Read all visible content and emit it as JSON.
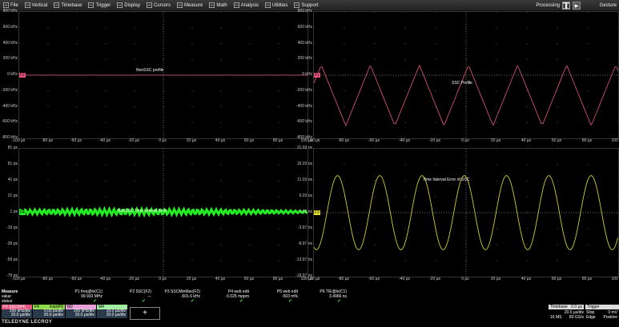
{
  "menu": {
    "items": [
      {
        "label": "File",
        "icon": "file-icon"
      },
      {
        "label": "Vertical",
        "icon": "vertical-icon"
      },
      {
        "label": "Timebase",
        "icon": "timebase-icon"
      },
      {
        "label": "Trigger",
        "icon": "trigger-icon"
      },
      {
        "label": "Display",
        "icon": "display-icon"
      },
      {
        "label": "Cursors",
        "icon": "cursors-icon"
      },
      {
        "label": "Measure",
        "icon": "measure-icon"
      },
      {
        "label": "Math",
        "icon": "math-icon"
      },
      {
        "label": "Analysis",
        "icon": "analysis-icon"
      },
      {
        "label": "Utilities",
        "icon": "utilities-icon"
      },
      {
        "label": "Support",
        "icon": "support-icon"
      }
    ],
    "processing_label": "Processing",
    "gesture_label": "Gesture"
  },
  "colors": {
    "pink": "#e8557f",
    "green": "#22ee22",
    "yellow": "#e6e62e",
    "f4": "#8fdc4a",
    "m2": "#e8a0d8",
    "m4": "#a0f0a0"
  },
  "panels": {
    "tl": {
      "yticks": [
        "800 kHz",
        "600 kHz",
        "400 kHz",
        "200 kHz",
        "0 kHz",
        "-200 kHz",
        "-400 kHz",
        "-600 kHz",
        "-800 kHz"
      ],
      "xticks": [
        "-100 µs",
        "-80 µs",
        "-60 µs",
        "-40 µs",
        "-20 µs",
        "0 µs",
        "20 µs",
        "40 µs",
        "60 µs",
        "80 µs",
        "100 µs"
      ],
      "annotation": "NonSSC profile",
      "marker": "F2"
    },
    "tr": {
      "yticks": [
        "800 kHz",
        "600 kHz",
        "400 kHz",
        "200 kHz",
        "0 kHz",
        "-200 kHz",
        "-400 kHz",
        "-600 kHz",
        "-800 kHz"
      ],
      "xticks": [
        "-100 µs",
        "-80 µs",
        "-60 µs",
        "-40 µs",
        "-20 µs",
        "0 µs",
        "20 µs",
        "40 µs",
        "60 µs",
        "80 µs",
        "100 µs"
      ],
      "annotation": "SSC Profile",
      "marker": "F1"
    },
    "bl": {
      "yticks": [
        "81 ps",
        "61 ps",
        "41 ps",
        "21 ps",
        "1 ps",
        "-19 ps",
        "-39 ps",
        "-59 ps",
        "-79 ps"
      ],
      "xticks": [
        "-100 µs",
        "-80 µs",
        "-60 µs",
        "-40 µs",
        "-20 µs",
        "0 µs",
        "20 µs",
        "40 µs",
        "60 µs",
        "80 µs",
        "100 µs"
      ],
      "annotation": "NonSSC Time Interval Error",
      "marker": "F4"
    },
    "br": {
      "yticks": [
        "21.03 ns",
        "16.03 ns",
        "11.03 ns",
        "6.03 ns",
        "1.03 ns",
        "-3.97 ns",
        "-8.97 ns",
        "-13.97 ns",
        "-18.97 ns"
      ],
      "xticks": [
        "-100 µs",
        "-80 µs",
        "-60 µs",
        "-40 µs",
        "-20 µs",
        "0 µs",
        "20 µs",
        "40 µs",
        "60 µs",
        "80 µs",
        "100 µs"
      ],
      "annotation": "Time Interval Error of SSC",
      "marker": "F3"
    }
  },
  "measure": {
    "row_labels": [
      "Measure",
      "value",
      "status"
    ],
    "params": [
      {
        "name": "P1 freq@lv(C1)",
        "value": "99.933 MHz"
      },
      {
        "name": "P2 SSC(F2)",
        "value": "---"
      },
      {
        "name": "P3 SSCMinMax(F2)",
        "value": "-501.6 kHz"
      },
      {
        "name": "P4 web edit",
        "value": "-5.025 mppm"
      },
      {
        "name": "P5 web edit",
        "value": "-503 m%"
      },
      {
        "name": "P6 TIE@lv(C1)",
        "value": "3.4966 ns"
      }
    ]
  },
  "descriptors": [
    {
      "name": "F2 SSC(M4)",
      "line1": "200 kHz/div",
      "line2": "20.0 µs/div"
    },
    {
      "name": "F4",
      "line1": "trackP6",
      "line2": "5.00 ps/div",
      "line3": "20.0 µs/div"
    },
    {
      "name": "M2",
      "line1": "200 kHz/div",
      "line2": "20.0 µs/div"
    },
    {
      "name": "M4",
      "line1": "20.0 µs/div",
      "line2": "20.0 µs/div"
    }
  ],
  "timebase": {
    "label": "Timebase",
    "delay": "0.0 µs",
    "trigger_label": "Trigger",
    "tdiv": "20.0 µs/div",
    "samples": "16 MS",
    "rate": "80 GS/s",
    "mode": "Stop",
    "type": "Edge",
    "level": "0 mV",
    "slope": "Positive"
  },
  "brand": "TELEDYNE LECROY"
}
